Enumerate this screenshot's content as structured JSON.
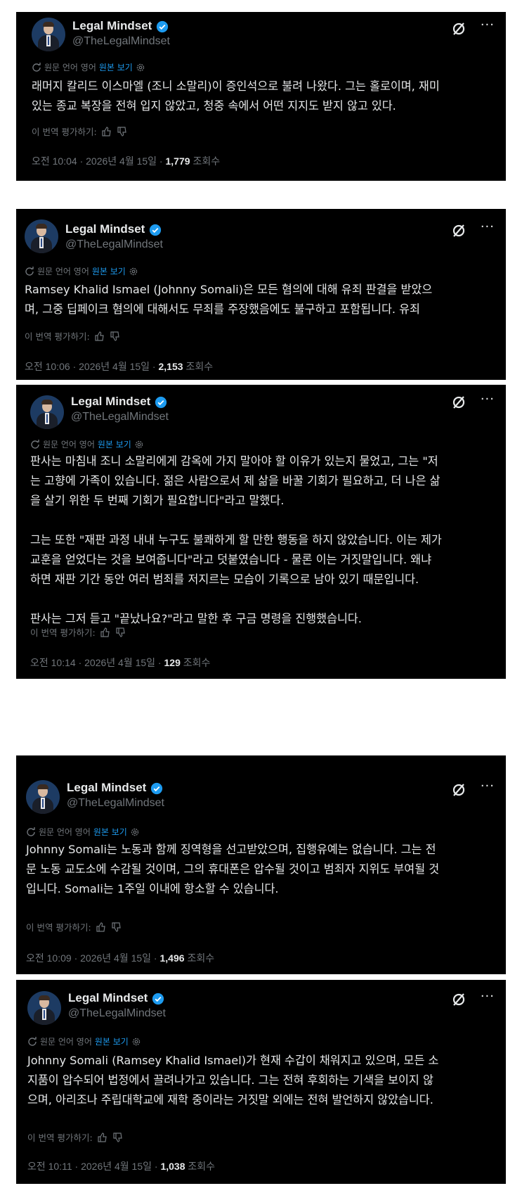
{
  "author": {
    "name": "Legal Mindset",
    "handle": "@TheLegalMindset"
  },
  "translation": {
    "label": "원문 언어 영어",
    "show_original": "원본 보기"
  },
  "rate_label": "이 번역 평가하기:",
  "views_label": "조회수",
  "colors": {
    "background": "#000000",
    "text": "#e7e9ea",
    "muted": "#71767b",
    "link": "#1d9bf0",
    "verified": "#1d9bf0"
  },
  "icons": [
    "translate-icon",
    "gear-icon",
    "verified-badge-icon",
    "grok-icon",
    "more-icon",
    "thumbs-up-icon",
    "thumbs-down-icon"
  ],
  "tweets": [
    {
      "body": "래머지 칼리드 이스마엘 (조니 소말리)이 증인석으로 불려 나왔다. 그는 홀로이며, 재미\n있는 종교 복장을 전혀 입지 않았고, 청중 속에서 어떤 지지도 받지 않고 있다.",
      "time": "오전 10:04 · 2026년 4월 15일 · ",
      "views": "1,779"
    },
    {
      "body": "Ramsey Khalid Ismael (Johnny Somali)은 모든 혐의에 대해 유죄 판결을 받았으\n며, 그중 딥페이크 혐의에 대해서도 무죄를 주장했음에도 불구하고 포함됩니다. 유죄",
      "time": "오전 10:06 · 2026년 4월 15일 · ",
      "views": "2,153"
    },
    {
      "body": "판사는 마침내 조니 소말리에게 감옥에 가지 말아야 할 이유가 있는지 물었고, 그는 \"저\n는 고향에 가족이 있습니다. 젊은 사람으로서 제 삶을 바꿀 기회가 필요하고, 더 나은 삶\n을 살기 위한 두 번째 기회가 필요합니다\"라고 말했다.\n\n그는 또한 \"재판 과정 내내 누구도 불쾌하게 할 만한 행동을 하지 않았습니다. 이는 제가\n교훈을 얻었다는 것을 보여줍니다\"라고 덧붙였습니다 - 물론 이는 거짓말입니다. 왜냐\n하면 재판 기간 동안 여러 범죄를 저지르는 모습이 기록으로 남아 있기 때문입니다.\n\n판사는 그저 듣고 \"끝났나요?\"라고 말한 후 구금 명령을 진행했습니다.",
      "time": "오전 10:14 · 2026년 4월 15일 · ",
      "views": "129"
    },
    {
      "body": "Johnny Somali는 노동과 함께 징역형을 선고받았으며, 집행유예는 없습니다. 그는 전\n문 노동 교도소에 수감될 것이며, 그의 휴대폰은 압수될 것이고 범죄자 지위도 부여될 것\n입니다. Somali는 1주일 이내에 항소할 수 있습니다.",
      "time": "오전 10:09 · 2026년 4월 15일 · ",
      "views": "1,496"
    },
    {
      "body": "Johnny Somali (Ramsey Khalid Ismael)가 현재 수갑이 채워지고 있으며, 모든 소\n지품이 압수되어 법정에서 끌려나가고 있습니다. 그는 전혀 후회하는 기색을 보이지 않\n으며, 아리조나 주립대학교에 재학 중이라는 거짓말 외에는 전혀 발언하지 않았습니다.",
      "time": "오전 10:11 · 2026년 4월 15일 · ",
      "views": "1,038"
    }
  ]
}
